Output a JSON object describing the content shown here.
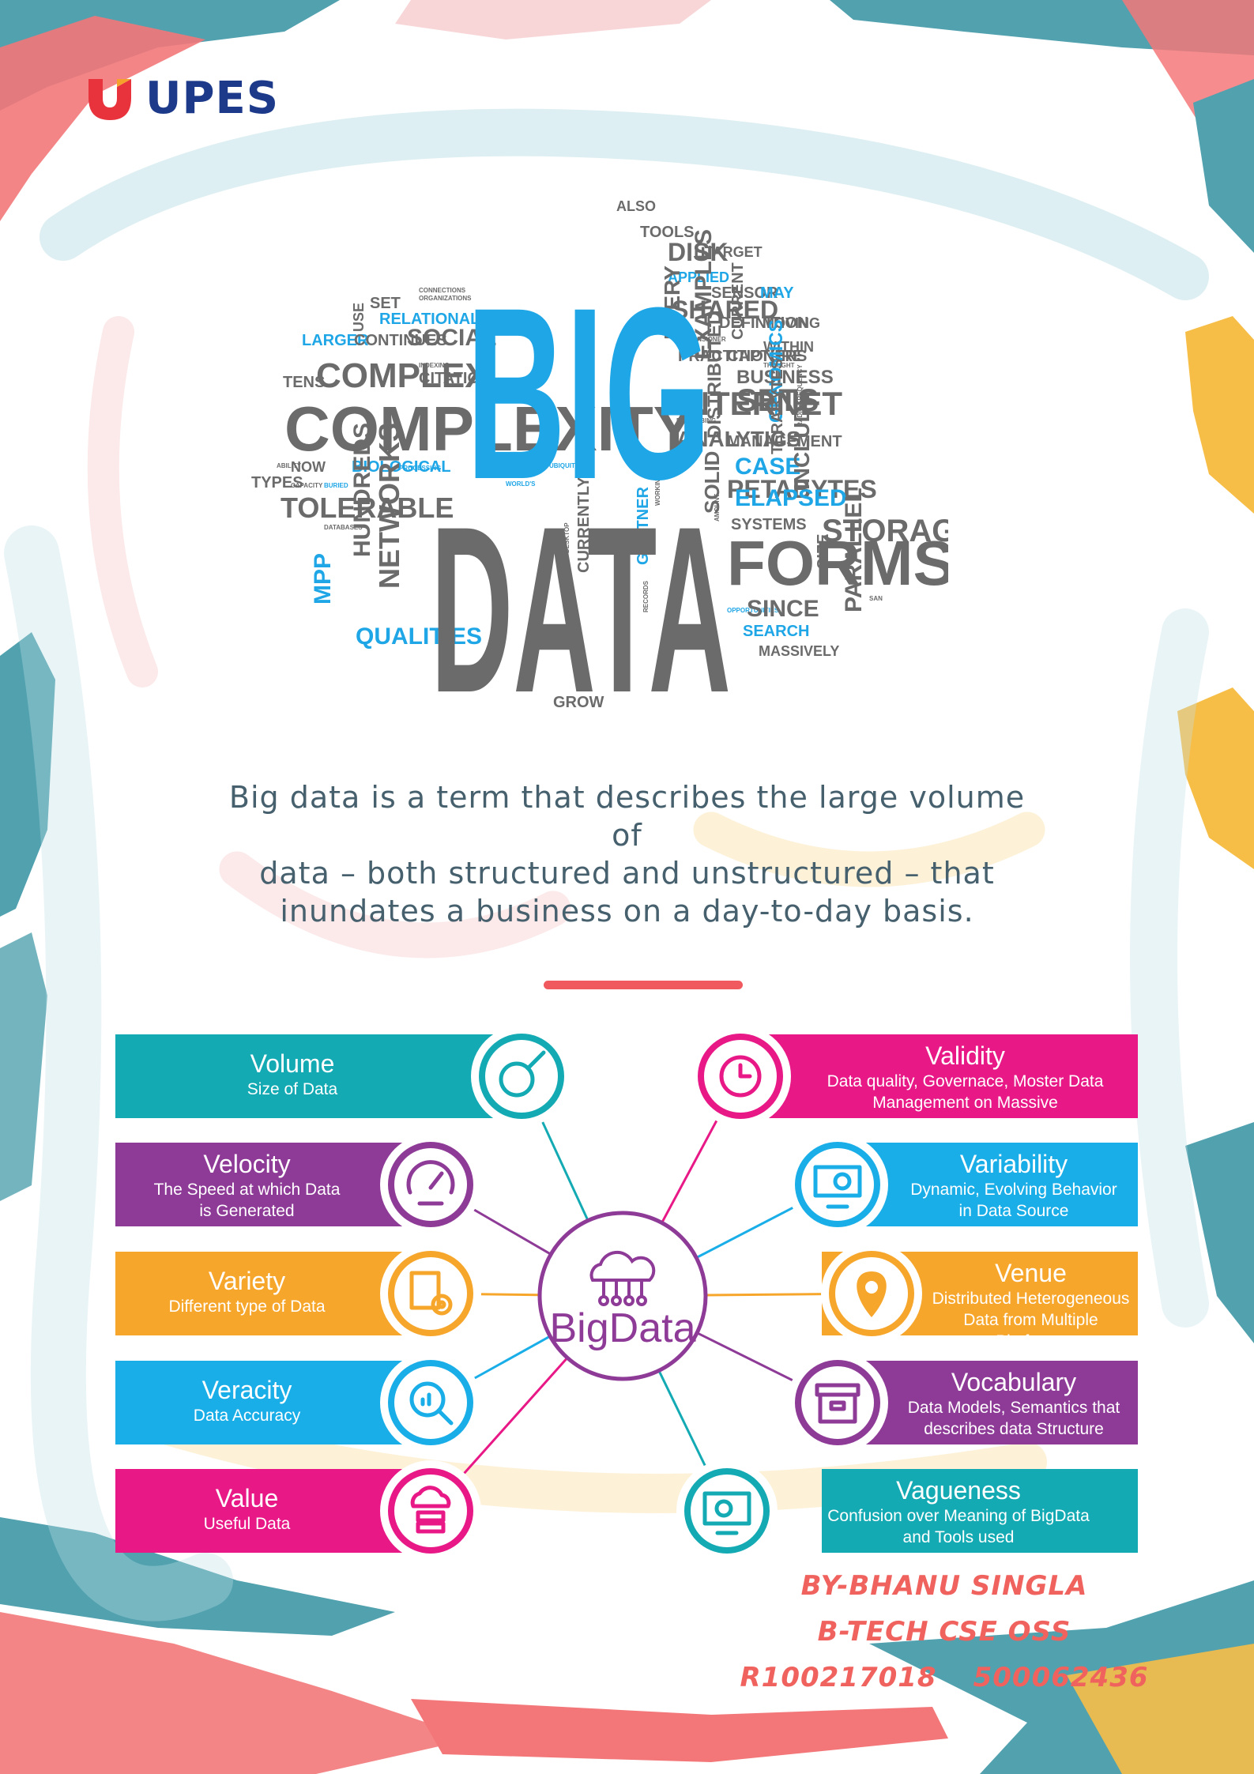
{
  "brand": {
    "name": "UPES"
  },
  "word_cloud": {
    "headline_1": "BIG",
    "headline_2": "DATA",
    "words": [
      "ALSO",
      "TOOLS",
      "DISK",
      "TARGET",
      "APPLIED",
      "SENSOR",
      "MAY",
      "EXAMPLES",
      "SHARED",
      "DEFINITION",
      "CURRENT",
      "MOVING",
      "WITHIN",
      "EVERY",
      "RECENSIONER",
      "PRACTITIONERS",
      "CAPTURE",
      "THOUGHT",
      "SET",
      "RELATIONAL",
      "USE",
      "CONNECTIONS",
      "ORGANIZATIONS",
      "LARGER",
      "CONTINUES",
      "SOCIAL",
      "INDEXING",
      "TENS",
      "COMPLEX",
      "CITATION",
      "BUSINESS",
      "SETS",
      "GENOMICS",
      "INTERNET",
      "DISTRIBUTED",
      "DESCRIBING",
      "RADIO-FREQUENCY",
      "COMPLEXITY",
      "ANALYTICS",
      "MANAGEMENT",
      "TERABYTES",
      "CASE",
      "PETABYTES",
      "INCLUDE",
      "ABILITY",
      "NOW",
      "BIOLOGICAL",
      "PROCESSING",
      "UBIQUITOUS",
      "TYPES",
      "CAPACITY",
      "BURIED",
      "WORLD'S",
      "SOLID",
      "ELAPSED",
      "SYSTEMS",
      "TOLERABLE",
      "HUNDREDS",
      "NETWORKS",
      "DATABASES",
      "DESKTOP",
      "CURRENTLY",
      "GARTNER",
      "WORKING",
      "AMOUNT",
      "FORMS",
      "STORAGE",
      "SIZE",
      "MPP",
      "RECORDS",
      "OPPORTUNITIES",
      "SINCE",
      "PARALLEL",
      "SAN",
      "QUALITIES",
      "SEARCH",
      "MASSIVELY",
      "GROW",
      "DIFFICULTY"
    ]
  },
  "description": {
    "line1": "Big data is a term that describes the large volume of",
    "line2": "data – both structured and unstructured – that",
    "line3": "inundates a business on a day-to-day basis."
  },
  "diagram": {
    "center_label": "BigData",
    "left": [
      {
        "title": "Volume",
        "sub1": "Size of Data",
        "sub2": "",
        "color": "#13aab3",
        "icon": "magnifier-icon"
      },
      {
        "title": "Velocity",
        "sub1": "The Speed at which Data",
        "sub2": "is Generated",
        "color": "#8e3a97",
        "icon": "speedometer-icon"
      },
      {
        "title": "Variety",
        "sub1": "Different type of Data",
        "sub2": "",
        "color": "#f7a62c",
        "icon": "documents-gears-icon"
      },
      {
        "title": "Veracity",
        "sub1": "Data Accuracy",
        "sub2": "",
        "color": "#1aaee8",
        "icon": "chart-search-icon"
      },
      {
        "title": "Value",
        "sub1": "Useful Data",
        "sub2": "",
        "color": "#e81887",
        "icon": "cloud-server-icon"
      }
    ],
    "right": [
      {
        "title": "Validity",
        "sub1": "Data quality, Governace, Moster Data",
        "sub2": "Management on Massive",
        "color": "#e81887",
        "icon": "clock-icon"
      },
      {
        "title": "Variability",
        "sub1": "Dynamic, Evolving Behavior",
        "sub2": "in Data Source",
        "color": "#1aaee8",
        "icon": "monitor-search-icon"
      },
      {
        "title": "Venue",
        "sub1": "Distributed Heterogeneous",
        "sub2": "Data from Multiple Platforms",
        "color": "#f7a62c",
        "icon": "location-pin-icon"
      },
      {
        "title": "Vocabulary",
        "sub1": "Data Models, Semantics that",
        "sub2": "describes data Structure",
        "color": "#8e3a97",
        "icon": "archive-box-icon"
      },
      {
        "title": "Vagueness",
        "sub1": "Confusion over Meaning of BigData",
        "sub2": "and Tools used",
        "color": "#13aab3",
        "icon": "monitor-gears-icon"
      }
    ]
  },
  "author": {
    "by_line": "BY-BHANU SINGLA",
    "course": "B-TECH CSE OSS",
    "roll": "R100217018",
    "sap": "500062436"
  },
  "colors": {
    "brand_blue": "#1d3a8a",
    "brand_red": "#e8323c",
    "cloud_blue": "#1fa6e6",
    "cloud_grey": "#6b6b6b",
    "accent_coral": "#f0625e"
  }
}
